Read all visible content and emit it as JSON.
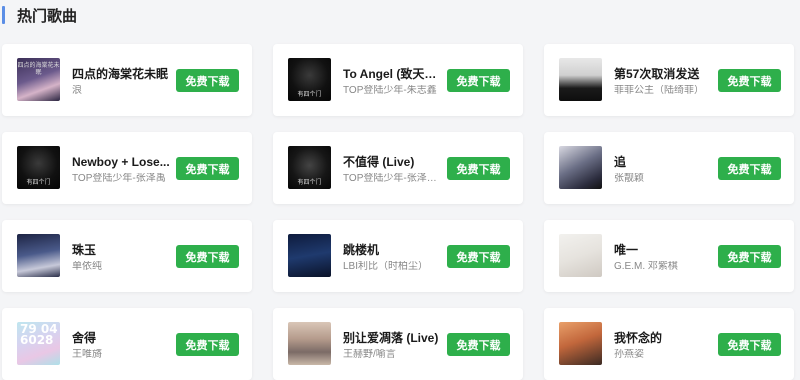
{
  "section": {
    "title": "热门歌曲"
  },
  "download_label": "免费下载",
  "colors": {
    "accent_bar": "#5b8ee6",
    "download_button": "#2eaf4b",
    "card_bg": "#ffffff",
    "page_bg": "#f4f5f7"
  },
  "songs": [
    {
      "title": "四点的海棠花未眠",
      "artist": "浪",
      "cover_text": "四点的海棠花未眠"
    },
    {
      "title": "To Angel (致天使)...",
      "artist": "TOP登陆少年-朱志鑫",
      "cover_text": "有四个门"
    },
    {
      "title": "第57次取消发送",
      "artist": "菲菲公主（陆绮菲）",
      "cover_text": ""
    },
    {
      "title": "Newboy + Lose...",
      "artist": "TOP登陆少年-张泽禹",
      "cover_text": "有四个门"
    },
    {
      "title": "不值得 (Live)",
      "artist": "TOP登陆少年-张泽禹/T...",
      "cover_text": "有四个门"
    },
    {
      "title": "追",
      "artist": "张靓颖",
      "cover_text": ""
    },
    {
      "title": "珠玉",
      "artist": "单依纯",
      "cover_text": ""
    },
    {
      "title": "跳楼机",
      "artist": "LBI利比（时柏尘）",
      "cover_text": ""
    },
    {
      "title": "唯一",
      "artist": "G.E.M. 邓紫棋",
      "cover_text": ""
    },
    {
      "title": "舍得",
      "artist": "王唯旖",
      "cover_text": "79 04 6028"
    },
    {
      "title": "别让爱凋落 (Live)",
      "artist": "王赫野/喻言",
      "cover_text": ""
    },
    {
      "title": "我怀念的",
      "artist": "孙燕姿",
      "cover_text": ""
    }
  ]
}
